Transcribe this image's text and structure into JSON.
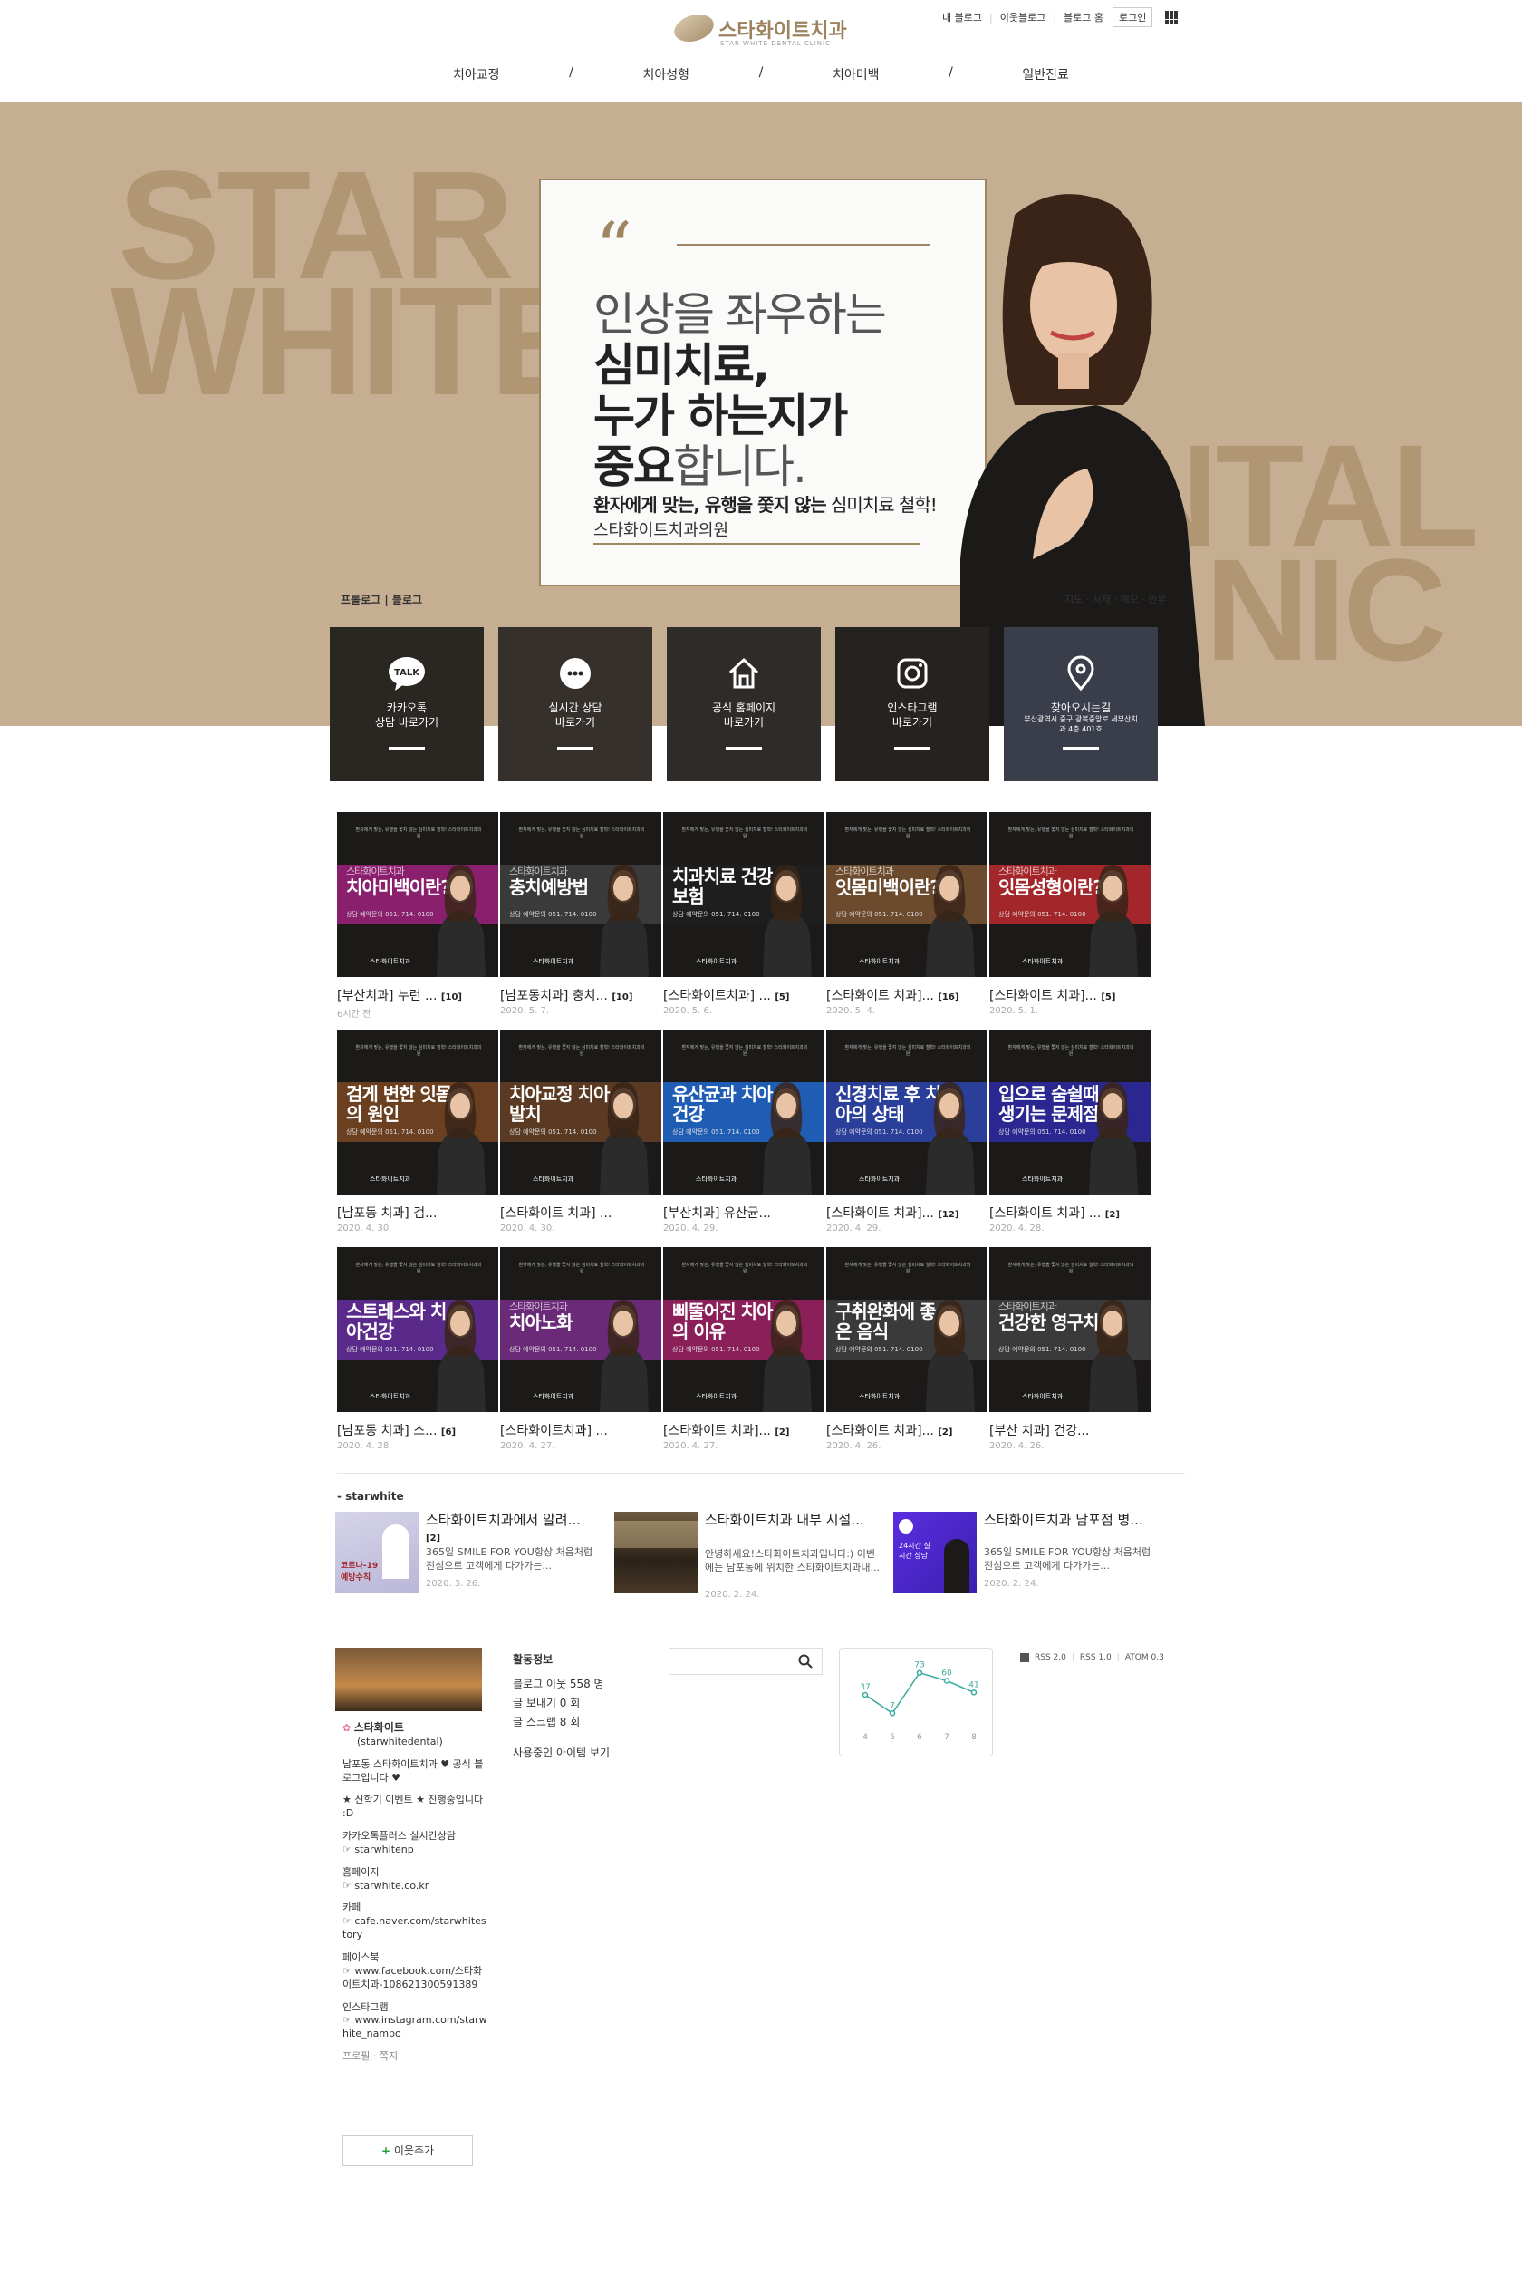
{
  "header": {
    "logo_name": "스타화이트치과",
    "logo_sub": "STAR WHITE DENTAL CLINIC",
    "top_links": [
      "내 블로그",
      "이웃블로그",
      "블로그 홈"
    ],
    "login": "로그인",
    "menu": [
      "치아교정",
      "/",
      "치아성형",
      "/",
      "치아미백",
      "/",
      "일반진료"
    ]
  },
  "banner": {
    "bg_text": [
      "STAR",
      "WHITE",
      "NTAL",
      "NIC"
    ],
    "line1": "인상을 좌우하는",
    "line2": "심미치료,",
    "line3": "누가 하는지가",
    "line4_bold": "중요",
    "line4_rest": "합니다.",
    "sub_bold": "환자에게 맞는, 유행을 쫓지 않는",
    "sub_rest": " 심미치료 철학!",
    "clinic": "스타화이트치과의원",
    "links_left": "프롤로그 | 블로그",
    "links_right": "지도 · 서재 · 메모 · 안부"
  },
  "link_buttons": [
    {
      "icon": "kakao-talk-icon",
      "line1": "카카오톡",
      "line2": "상담 바로가기"
    },
    {
      "icon": "chat-icon",
      "line1": "실시간 상담",
      "line2": "바로가기"
    },
    {
      "icon": "home-icon",
      "line1": "공식 홈페이지",
      "line2": "바로가기"
    },
    {
      "icon": "instagram-icon",
      "line1": "인스타그램",
      "line2": "바로가기"
    },
    {
      "icon": "map-pin-icon",
      "line1": "찾아오시는길",
      "line2": "부산광역시 중구 광복중앙로 세부산치과 4층 401호"
    }
  ],
  "posts": [
    {
      "thumb_title": "치아미백이란?",
      "thumb_pre": "스타화이트치과",
      "color": "#8a1f6e",
      "caption": "[부산치과] 누런 ...",
      "count": "[10]",
      "date": "6시간 전"
    },
    {
      "thumb_title": "충치예방법",
      "thumb_pre": "스타화이트치과",
      "color": "#3a3a3a",
      "caption": "[남포동치과] 충치...",
      "count": "[10]",
      "date": "2020. 5. 7."
    },
    {
      "thumb_title": "치과치료 건강보험",
      "thumb_pre": "",
      "color": "#1e1e1e",
      "caption": "[스타화이트치과] ...",
      "count": "[5]",
      "date": "2020. 5. 6."
    },
    {
      "thumb_title": "잇몸미백이란?",
      "thumb_pre": "스타화이트치과",
      "color": "#6b4a2e",
      "caption": "[스타화이트 치과]...",
      "count": "[16]",
      "date": "2020. 5. 4."
    },
    {
      "thumb_title": "잇몸성형이란?",
      "thumb_pre": "스타화이트치과",
      "color": "#a3262a",
      "caption": "[스타화이트 치과]...",
      "count": "[5]",
      "date": "2020. 5. 1."
    },
    {
      "thumb_title": "검게 변한 잇몸의 원인",
      "thumb_pre": "",
      "color": "#6b4020",
      "caption": "[남포동 치과] 검...",
      "count": "",
      "date": "2020. 4. 30."
    },
    {
      "thumb_title": "치아교정 치아발치",
      "thumb_pre": "",
      "color": "#5a3a22",
      "caption": "[스타화이트 치과] ...",
      "count": "",
      "date": "2020. 4. 30."
    },
    {
      "thumb_title": "유산균과 치아 건강",
      "thumb_pre": "",
      "color": "#1f5db5",
      "caption": "[부산치과] 유산균...",
      "count": "",
      "date": "2020. 4. 29."
    },
    {
      "thumb_title": "신경치료 후 치아의 상태",
      "thumb_pre": "",
      "color": "#2a3f9a",
      "caption": "[스타화이트 치과]...",
      "count": "[12]",
      "date": "2020. 4. 29."
    },
    {
      "thumb_title": "입으로 숨쉴때 생기는 문제점",
      "thumb_pre": "",
      "color": "#2a2890",
      "caption": "[스타화이트 치과] ...",
      "count": "[2]",
      "date": "2020. 4. 28."
    },
    {
      "thumb_title": "스트레스와 치아건강",
      "thumb_pre": "",
      "color": "#5a2a8a",
      "caption": "[남포동 치과] 스...",
      "count": "[6]",
      "date": "2020. 4. 28."
    },
    {
      "thumb_title": "치아노화",
      "thumb_pre": "스타화이트치과",
      "color": "#6a2a78",
      "caption": "[스타화이트치과] ...",
      "count": "",
      "date": "2020. 4. 27."
    },
    {
      "thumb_title": "삐뚤어진 치아의 이유",
      "thumb_pre": "",
      "color": "#8a1f5a",
      "caption": "[스타화이트 치과]...",
      "count": "[2]",
      "date": "2020. 4. 27."
    },
    {
      "thumb_title": "구취완화에 좋은 음식",
      "thumb_pre": "",
      "color": "#3a3a3a",
      "caption": "[스타화이트 치과]...",
      "count": "[2]",
      "date": "2020. 4. 26."
    },
    {
      "thumb_title": "건강한 영구치",
      "thumb_pre": "스타화이트치과",
      "color": "#3a3a3a",
      "caption": "[부산 치과] 건강...",
      "count": "",
      "date": "2020. 4. 26."
    }
  ],
  "thumb_common": {
    "header": "환자에게 맞는, 유행을 쫓지 않는 심미치료 철학! 스타화이트치과의원",
    "phone": "상담 예약문의 051. 714. 0100",
    "logo": "스타화이트치과"
  },
  "related": {
    "head": "- starwhite",
    "items": [
      {
        "title": "스타화이트치과에서 알려...",
        "count": "[2]",
        "desc": "365일 SMILE FOR YOU항상 처음처럼 진심으로 고객에게 다가가는...",
        "date": "2020. 3. 26.",
        "thumb_text": "코로나-19 예방수칙"
      },
      {
        "title": "스타화이트치과 내부 시설...",
        "count": "",
        "desc": "안녕하세요!스타화이트치과입니다:) 이번에는 남포동에 위치한 스타화이트치과내...",
        "date": "2020. 2. 24.",
        "thumb_text": ""
      },
      {
        "title": "스타화이트치과 남포점 병...",
        "count": "",
        "desc": "365일 SMILE FOR YOU항상 처음처럼 진심으로 고객에게 다가가는...",
        "date": "2020. 2. 24.",
        "thumb_text": "24시간 실시간 상담"
      }
    ]
  },
  "profile": {
    "name": "스타화이트",
    "id": "(starwhitedental)",
    "intro": "남포동 스타화이트치과 ♥ 공식 블로그입니다 ♥",
    "event": "★ 신학기 이벤트 ★ 진행중입니다 :D",
    "kakao_label": "카카오톡플러스 실시간상담",
    "kakao_val": "☞ starwhitenp",
    "home_label": "홈페이지",
    "home_val": "☞ starwhite.co.kr",
    "cafe_label": "카페",
    "cafe_val": "☞ cafe.naver.com/starwhitestory",
    "fb_label": "페이스북",
    "fb_val": "☞ www.facebook.com/스타화이트치과-108621300591389",
    "ig_label": "인스타그램",
    "ig_val": "☞ www.instagram.com/starwhite_nampo",
    "links": "프로필 · 쪽지",
    "add_neighbor": "이웃추가"
  },
  "activity": {
    "title": "활동정보",
    "neighbors": "블로그 이웃 558 명",
    "posts": "글 보내기 0 회",
    "scraps": "글 스크랩 8 회",
    "items": "사용중인 아이템 보기"
  },
  "rss": [
    "RSS 2.0",
    "RSS 1.0",
    "ATOM 0.3"
  ],
  "chart_data": {
    "type": "line",
    "categories": [
      "4",
      "5",
      "6",
      "7",
      "8"
    ],
    "values": [
      37,
      7,
      73,
      60,
      41
    ],
    "color": "#3aa99f"
  }
}
